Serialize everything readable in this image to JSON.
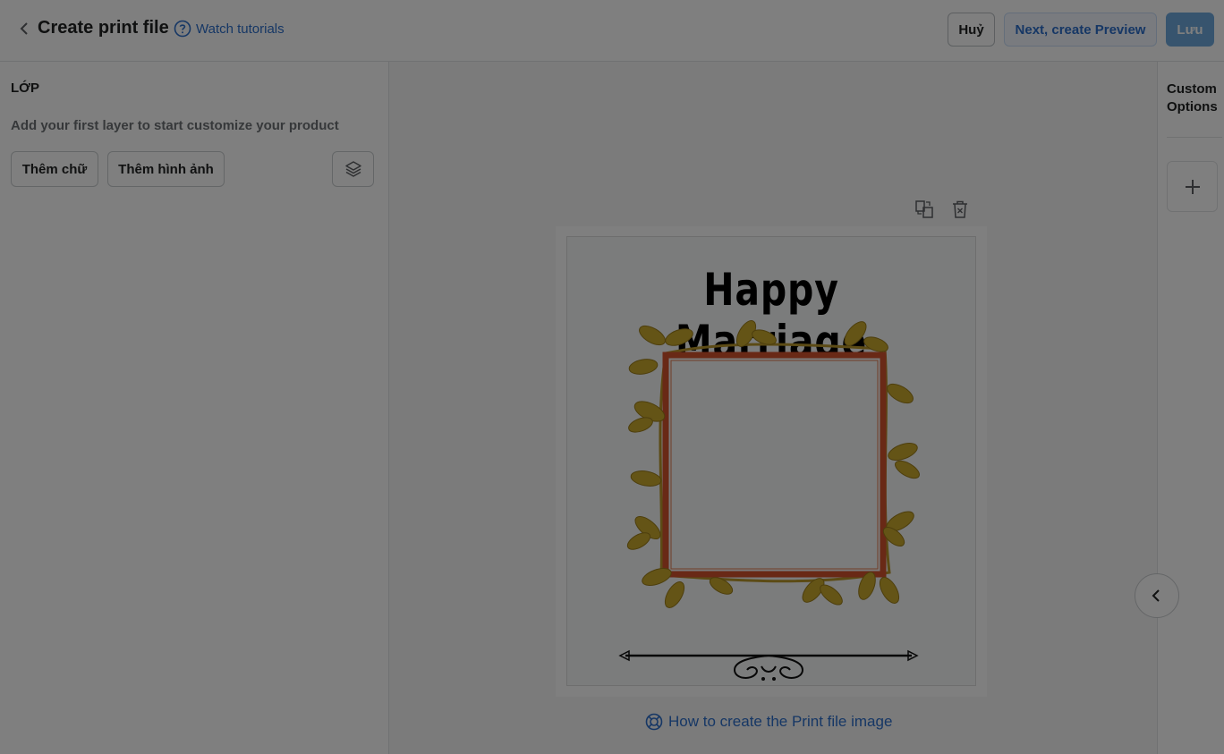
{
  "header": {
    "title": "Create print file",
    "watch_label": "Watch tutorials",
    "cancel_label": "Huỷ",
    "preview_label": "Next, create Preview",
    "save_label": "Lưu"
  },
  "layers": {
    "title": "LỚP",
    "hint": "Add your first layer to start customize your product",
    "add_text_label": "Thêm chữ",
    "add_image_label": "Thêm hình ảnh"
  },
  "canvas": {
    "print_title": "Happy Marriage",
    "howto_label": "How to create the Print file image"
  },
  "custom_options": {
    "title": "Custom Options"
  },
  "colors": {
    "accent": "#2c6ecb",
    "save_bg": "#6fa8dc",
    "overlay": "rgba(0,0,0,0.5)",
    "frame_red": "#d2532c",
    "leaf_gold": "#c9a82c"
  },
  "icons": [
    "chevron-left-icon",
    "help-circle-icon",
    "layers-icon",
    "replace-icon",
    "trash-icon",
    "lifebuoy-icon",
    "plus-icon",
    "chevron-left-icon"
  ]
}
